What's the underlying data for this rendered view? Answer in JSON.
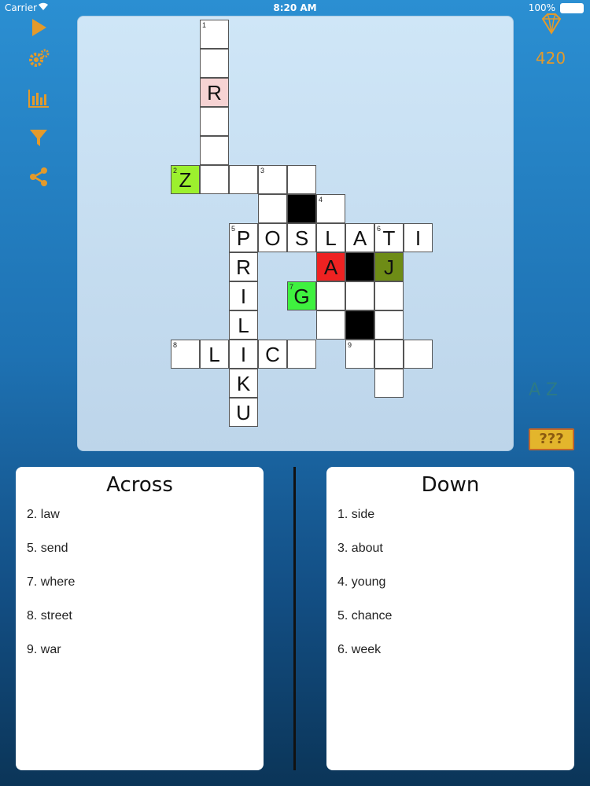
{
  "status": {
    "carrier": "Carrier",
    "time": "8:20 AM",
    "battery": "100%"
  },
  "toolbar": {
    "play_icon": "play-icon",
    "settings_icon": "gears-icon",
    "stats_icon": "bar-chart-icon",
    "filter_icon": "filter-icon",
    "share_icon": "share-icon",
    "accent_color": "#e39a2b"
  },
  "score": {
    "value": "420",
    "icon": "diamond-icon"
  },
  "az_label": "A Z",
  "hint_label": "???",
  "grid": {
    "cells": [
      {
        "row": 0,
        "col": 1,
        "num": "1",
        "letter": "",
        "style": "white"
      },
      {
        "row": 1,
        "col": 1,
        "num": "",
        "letter": "",
        "style": "white"
      },
      {
        "row": 2,
        "col": 1,
        "num": "",
        "letter": "R",
        "style": "pink"
      },
      {
        "row": 3,
        "col": 1,
        "num": "",
        "letter": "",
        "style": "white"
      },
      {
        "row": 4,
        "col": 1,
        "num": "",
        "letter": "",
        "style": "white"
      },
      {
        "row": 5,
        "col": 0,
        "num": "2",
        "letter": "Z",
        "style": "lime"
      },
      {
        "row": 5,
        "col": 1,
        "num": "",
        "letter": "",
        "style": "white"
      },
      {
        "row": 5,
        "col": 2,
        "num": "",
        "letter": "",
        "style": "white"
      },
      {
        "row": 5,
        "col": 3,
        "num": "3",
        "letter": "",
        "style": "white"
      },
      {
        "row": 5,
        "col": 4,
        "num": "",
        "letter": "",
        "style": "white"
      },
      {
        "row": 6,
        "col": 3,
        "num": "",
        "letter": "",
        "style": "white"
      },
      {
        "row": 6,
        "col": 4,
        "num": "",
        "letter": "",
        "style": "black"
      },
      {
        "row": 6,
        "col": 5,
        "num": "4",
        "letter": "",
        "style": "white"
      },
      {
        "row": 7,
        "col": 2,
        "num": "5",
        "letter": "P",
        "style": "white"
      },
      {
        "row": 7,
        "col": 3,
        "num": "",
        "letter": "O",
        "style": "white"
      },
      {
        "row": 7,
        "col": 4,
        "num": "",
        "letter": "S",
        "style": "white"
      },
      {
        "row": 7,
        "col": 5,
        "num": "",
        "letter": "L",
        "style": "white"
      },
      {
        "row": 7,
        "col": 6,
        "num": "",
        "letter": "A",
        "style": "white"
      },
      {
        "row": 7,
        "col": 7,
        "num": "6",
        "letter": "T",
        "style": "white"
      },
      {
        "row": 7,
        "col": 8,
        "num": "",
        "letter": "I",
        "style": "white"
      },
      {
        "row": 8,
        "col": 2,
        "num": "",
        "letter": "R",
        "style": "white"
      },
      {
        "row": 8,
        "col": 5,
        "num": "",
        "letter": "A",
        "style": "red"
      },
      {
        "row": 8,
        "col": 6,
        "num": "",
        "letter": "",
        "style": "black"
      },
      {
        "row": 8,
        "col": 7,
        "num": "",
        "letter": "J",
        "style": "olive"
      },
      {
        "row": 9,
        "col": 2,
        "num": "",
        "letter": "I",
        "style": "white"
      },
      {
        "row": 9,
        "col": 4,
        "num": "7",
        "letter": "G",
        "style": "green"
      },
      {
        "row": 9,
        "col": 5,
        "num": "",
        "letter": "",
        "style": "white"
      },
      {
        "row": 9,
        "col": 6,
        "num": "",
        "letter": "",
        "style": "white"
      },
      {
        "row": 9,
        "col": 7,
        "num": "",
        "letter": "",
        "style": "white"
      },
      {
        "row": 10,
        "col": 2,
        "num": "",
        "letter": "L",
        "style": "white"
      },
      {
        "row": 10,
        "col": 5,
        "num": "",
        "letter": "",
        "style": "white"
      },
      {
        "row": 10,
        "col": 6,
        "num": "",
        "letter": "",
        "style": "black"
      },
      {
        "row": 10,
        "col": 7,
        "num": "",
        "letter": "",
        "style": "white"
      },
      {
        "row": 11,
        "col": 0,
        "num": "8",
        "letter": "",
        "style": "white"
      },
      {
        "row": 11,
        "col": 1,
        "num": "",
        "letter": "L",
        "style": "white"
      },
      {
        "row": 11,
        "col": 2,
        "num": "",
        "letter": "I",
        "style": "white"
      },
      {
        "row": 11,
        "col": 3,
        "num": "",
        "letter": "C",
        "style": "white"
      },
      {
        "row": 11,
        "col": 4,
        "num": "",
        "letter": "",
        "style": "white"
      },
      {
        "row": 11,
        "col": 6,
        "num": "9",
        "letter": "",
        "style": "white"
      },
      {
        "row": 11,
        "col": 7,
        "num": "",
        "letter": "",
        "style": "white"
      },
      {
        "row": 11,
        "col": 8,
        "num": "",
        "letter": "",
        "style": "white"
      },
      {
        "row": 12,
        "col": 2,
        "num": "",
        "letter": "K",
        "style": "white"
      },
      {
        "row": 12,
        "col": 7,
        "num": "",
        "letter": "",
        "style": "white"
      },
      {
        "row": 13,
        "col": 2,
        "num": "",
        "letter": "U",
        "style": "white"
      }
    ]
  },
  "across": {
    "title": "Across",
    "clues": [
      "2. law",
      "5. send",
      "7. where",
      "8. street",
      "9. war"
    ]
  },
  "down": {
    "title": "Down",
    "clues": [
      "1. side",
      "3. about",
      "4. young",
      "5. chance",
      "6. week"
    ]
  }
}
